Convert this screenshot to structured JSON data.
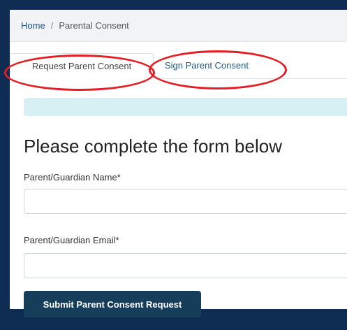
{
  "breadcrumb": {
    "home": "Home",
    "separator": "/",
    "current": "Parental Consent"
  },
  "tabs": [
    {
      "label": "Request Parent Consent",
      "active": true
    },
    {
      "label": "Sign Parent Consent",
      "active": false
    }
  ],
  "form": {
    "title": "Please complete the form below",
    "name_label": "Parent/Guardian Name*",
    "name_value": "",
    "email_label": "Parent/Guardian Email*",
    "email_value": "",
    "submit_label": "Submit Parent Consent Request"
  },
  "colors": {
    "page_frame": "#0f2d52",
    "annotation_ring": "#e31e24",
    "button": "#163e5b",
    "alert": "#d6f0f3",
    "link": "#1d5a8e"
  }
}
